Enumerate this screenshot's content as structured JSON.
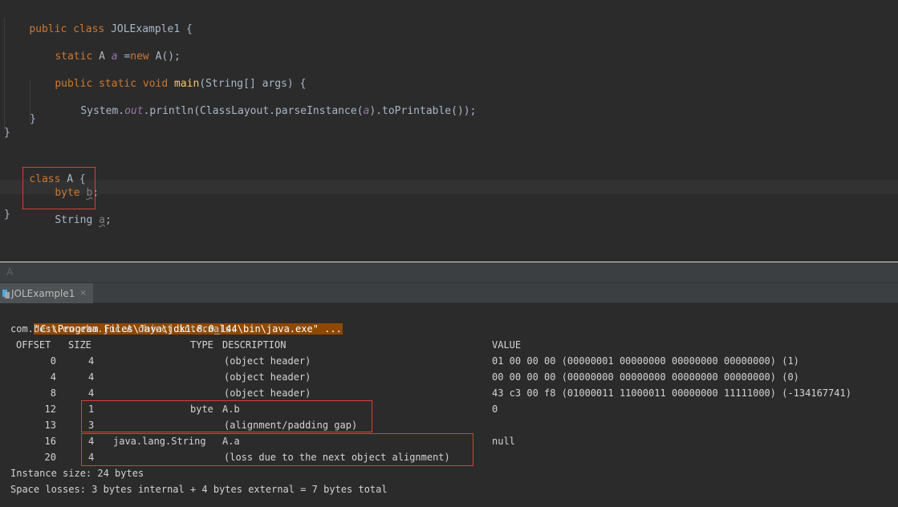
{
  "editor": {
    "line1": {
      "kw": "public class ",
      "name": "JOLExample1",
      "rest": " {"
    },
    "line2": {
      "kw": "static ",
      "type": "A ",
      "name": "a",
      "eq": " =",
      "kw2": "new ",
      "ctor": "A",
      "rest": "();"
    },
    "line3": {
      "kw": "public static void ",
      "fn": "main",
      "open": "(",
      "type": "String",
      "rest": "[] args) {"
    },
    "line4": {
      "obj": "System",
      "dot1": ".",
      "field": "out",
      "dot2": ".",
      "method": "println",
      "open": "(",
      "cls": "ClassLayout",
      "dot3": ".",
      "method2": "parseInstance",
      "open2": "(",
      "arg": "a",
      "close": ").",
      "method3": "toPrintable",
      "rest": "());"
    },
    "line5": "}",
    "line6": "}",
    "line7": {
      "kw": "class ",
      "name": "A",
      "rest": " {"
    },
    "line8": {
      "kw": "byte ",
      "name": "b",
      "rest": ";"
    },
    "line9": {
      "type": "String ",
      "name": "a",
      "rest": ";"
    },
    "line10": "}"
  },
  "breadcrumb": "A",
  "run_tab": {
    "label": "JOLExample1",
    "close": "×"
  },
  "console": {
    "command": "\"C:\\Program Files\\Java\\jdk1.8.0_144\\bin\\java.exe\" ...",
    "header": "com.best.eureka.juc.A object internals:",
    "columns": {
      "offset": "OFFSET",
      "size": "SIZE",
      "type": "TYPE",
      "description": "DESCRIPTION",
      "value": "VALUE"
    },
    "rows": [
      {
        "offset": "0",
        "size": "4",
        "type": "",
        "description": "(object header)",
        "value": "01 00 00 00 (00000001 00000000 00000000 00000000) (1)"
      },
      {
        "offset": "4",
        "size": "4",
        "type": "",
        "description": "(object header)",
        "value": "00 00 00 00 (00000000 00000000 00000000 00000000) (0)"
      },
      {
        "offset": "8",
        "size": "4",
        "type": "",
        "description": "(object header)",
        "value": "43 c3 00 f8 (01000011 11000011 00000000 11111000) (-134167741)"
      },
      {
        "offset": "12",
        "size": "1",
        "type": "byte",
        "description": "A.b",
        "value": "0"
      },
      {
        "offset": "13",
        "size": "3",
        "type": "",
        "description": "(alignment/padding gap)",
        "value": ""
      },
      {
        "offset": "16",
        "size": "4",
        "type": "java.lang.String",
        "description": "A.a",
        "value": "null"
      },
      {
        "offset": "20",
        "size": "4",
        "type": "",
        "description": "(loss due to the next object alignment)",
        "value": ""
      }
    ],
    "instance_size": "Instance size: 24 bytes",
    "space_losses": "Space losses: 3 bytes internal + 4 bytes external = 7 bytes total"
  },
  "colors": {
    "editor_bg": "#2b2b2b",
    "keyword": "#cc7832",
    "method": "#ffc66d",
    "static_field": "#9876aa",
    "highlight_box": "#e03c3c",
    "command_bg": "#8f4800"
  }
}
